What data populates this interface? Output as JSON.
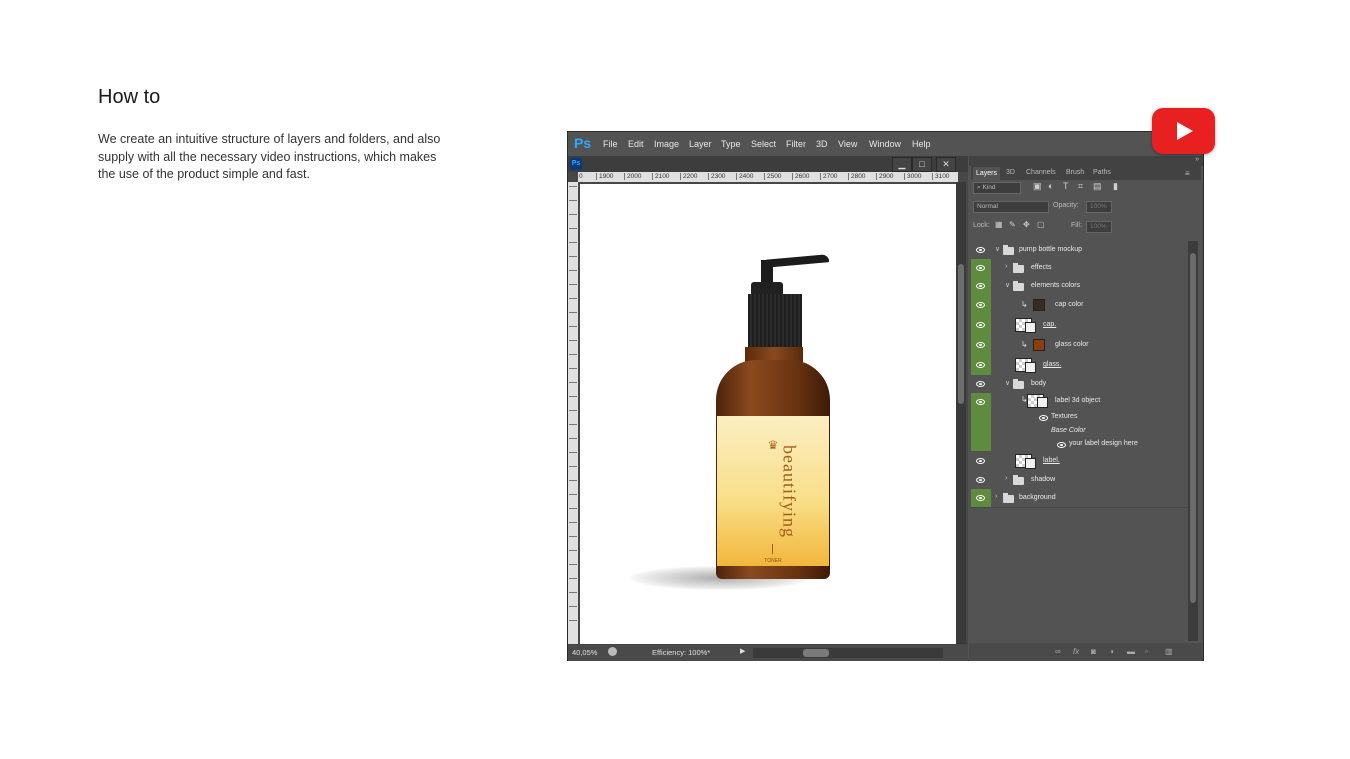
{
  "intro": {
    "title": "How to",
    "description": "We create an intuitive structure of layers and folders, and also supply with all the necessary video instructions, which makes the use of the product simple and fast."
  },
  "youtube": {
    "icon": "play-icon",
    "color": "#e8201f"
  },
  "photoshop": {
    "logo": "Ps",
    "menu": [
      "File",
      "Edit",
      "Image",
      "Layer",
      "Type",
      "Select",
      "Filter",
      "3D",
      "View",
      "Window",
      "Help"
    ],
    "doc_tab": {
      "logo": "Ps",
      "minimize": "▁",
      "maximize": "□",
      "close": "✕"
    },
    "ruler_top": [
      "0",
      "1900",
      "2000",
      "2100",
      "2200",
      "2300",
      "2400",
      "2500",
      "2600",
      "2700",
      "2800",
      "2900",
      "3000",
      "3100"
    ],
    "canvas_label": {
      "brand": "beautifying",
      "product": "TONER",
      "crown": "♛"
    },
    "status": {
      "zoom": "40,05%",
      "efficiency": "Efficiency: 100%*"
    },
    "panels": {
      "tabs": [
        "Layers",
        "3D",
        "Channels",
        "Brush",
        "Paths"
      ],
      "active_tab": "Layers",
      "kind_filter": "Kind",
      "blend_mode": "Normal",
      "opacity_label": "Opacity:",
      "opacity_value": "100%",
      "lock_label": "Lock:",
      "fill_label": "Fill:",
      "fill_value": "100%",
      "layers": [
        {
          "name": "pump bottle mockup",
          "kind": "folder",
          "expanded": true,
          "visible": false
        },
        {
          "name": "effects",
          "kind": "folder",
          "expanded": false,
          "visible": true
        },
        {
          "name": "elements colors",
          "kind": "folder",
          "expanded": true,
          "visible": true
        },
        {
          "name": "cap color",
          "kind": "fill",
          "color": "#3b2a22",
          "visible": true
        },
        {
          "name": "cap.",
          "kind": "smart",
          "visible": true
        },
        {
          "name": "glass color",
          "kind": "fill",
          "color": "#8c3d0e",
          "visible": true
        },
        {
          "name": "glass.",
          "kind": "smart",
          "visible": true
        },
        {
          "name": "body",
          "kind": "folder",
          "expanded": true,
          "visible": false
        },
        {
          "name": "label 3d object",
          "kind": "3d",
          "visible": true
        },
        {
          "name": "Textures",
          "kind": "sub"
        },
        {
          "name": "Base Color",
          "kind": "sub-italic"
        },
        {
          "name": "your label design here",
          "kind": "sub-leaf"
        },
        {
          "name": "label.",
          "kind": "smart",
          "visible": false
        },
        {
          "name": "shadow",
          "kind": "folder",
          "expanded": false,
          "visible": false
        },
        {
          "name": "background",
          "kind": "folder",
          "expanded": false,
          "visible": true
        }
      ]
    }
  }
}
